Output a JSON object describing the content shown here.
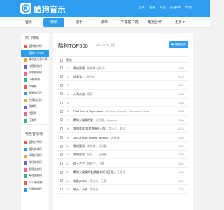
{
  "brand": {
    "name": "酷狗音乐"
  },
  "top_links": [
    "登录",
    "注册",
    "充值",
    "开通VIP",
    "帮助"
  ],
  "nav": {
    "items": [
      {
        "label": "首页",
        "active": false
      },
      {
        "label": "榜单",
        "active": true
      },
      {
        "label": "歌手",
        "active": false
      },
      {
        "label": "歌单",
        "active": false
      },
      {
        "label": "下载客户端",
        "active": false
      },
      {
        "label": "酷狗合作",
        "active": false
      },
      {
        "label": "更多 ▾",
        "active": false
      }
    ]
  },
  "sidebar": {
    "sections": [
      {
        "title": "热门榜单",
        "items": [
          {
            "label": "酷狗飙升榜",
            "color": "#e85d4f",
            "active": false
          },
          {
            "label": "酷狗TOP500",
            "color": "#2e9df0",
            "active": true
          },
          {
            "label": "蜂鸟流行音乐榜",
            "color": "#f3a33b",
            "active": false
          },
          {
            "label": "抖音热歌榜",
            "color": "#7a5cd6",
            "active": false
          },
          {
            "label": "快手热歌榜",
            "color": "#e86b8f",
            "active": false
          },
          {
            "label": "DJ热歌榜",
            "color": "#3bb18a",
            "active": false
          },
          {
            "label": "内地榜",
            "color": "#e85d4f",
            "active": false
          },
          {
            "label": "香港地区榜",
            "color": "#2e9df0",
            "active": false
          },
          {
            "label": "台湾地区榜",
            "color": "#f3a33b",
            "active": false
          },
          {
            "label": "欧美榜",
            "color": "#7a5cd6",
            "active": false
          },
          {
            "label": "韩国榜",
            "color": "#e86b8f",
            "active": false
          },
          {
            "label": "日本榜",
            "color": "#3bb18a",
            "active": false
          }
        ]
      },
      {
        "title": "特色音乐榜",
        "items": [
          {
            "label": "酷狗分享榜",
            "color": "#e85d4f",
            "active": false
          },
          {
            "label": "酷狗说唱榜",
            "color": "#2e9df0",
            "active": false
          },
          {
            "label": "网络红歌榜",
            "color": "#f3a33b",
            "active": false
          },
          {
            "label": "综艺新歌榜",
            "color": "#7a5cd6",
            "active": false
          },
          {
            "label": "影视金曲榜",
            "color": "#e86b8f",
            "active": false
          },
          {
            "label": "粤语金曲榜",
            "color": "#3bb18a",
            "active": false
          },
          {
            "label": "ACG新歌榜",
            "color": "#e85d4f",
            "active": false
          },
          {
            "label": "古风热歌榜",
            "color": "#2e9df0",
            "active": false
          }
        ]
      }
    ]
  },
  "main": {
    "title": "酷狗TOP500",
    "date": "2024-07-05 更新",
    "play_all": "▶ 播放全部",
    "header_label": "歌曲",
    "songs": [
      {
        "num": "1",
        "title": "晴也丽晴",
        "artist": "- 张碧晨/汪苏泷",
        "dur": "2:58"
      },
      {
        "num": "2",
        "title": "如果我...",
        "artist": "- 周杰伦",
        "dur": "4:02"
      },
      {
        "num": "3",
        "title": "",
        "artist": "",
        "dur": "3:17"
      },
      {
        "num": "4",
        "title": "入海未遂",
        "artist": "- 周深",
        "dur": "3:33"
      },
      {
        "num": "5",
        "title": "",
        "artist": "",
        "dur": "3:28"
      },
      {
        "num": "6",
        "title": "Fast Cars & Superstars",
        "artist": "- Christian Wunsch、Benoemd Haus",
        "dur": "3:04"
      },
      {
        "num": "7",
        "title": "覆如火候我的爱",
        "artist": "- 汪苏泷、Dannick",
        "dur": "3:16"
      },
      {
        "num": "8",
        "title": "我想要说(我爱你原创正版)",
        "artist": "- 音乐人、何洁",
        "dur": "4:01"
      },
      {
        "num": "9",
        "title": "Jar Of Love (Album Version)",
        "artist": "- 曲婉婷",
        "dur": "3:49"
      },
      {
        "num": "10",
        "title": "我想要说",
        "artist": "- 李晓婷、王苏鹏",
        "dur": "3:51"
      },
      {
        "num": "11",
        "title": "我想要说",
        "artist": "- 音乐人、王苏鹏",
        "dur": "3:59"
      },
      {
        "num": "12",
        "title": "执子之手",
        "artist": "- 陈楚生、一路",
        "dur": "3:41"
      },
      {
        "num": "13",
        "title": "覆如火候我的爱(我爱你原创正版)",
        "artist": "- 王雅涛",
        "dur": "4:02"
      },
      {
        "num": "14",
        "title": "安静(2023)",
        "artist": "- 周杰伦、王雅",
        "dur": "3:52"
      },
      {
        "num": "15",
        "title": "晴天、不流",
        "artist": "- 周杰伦",
        "dur": "3:20"
      }
    ]
  }
}
